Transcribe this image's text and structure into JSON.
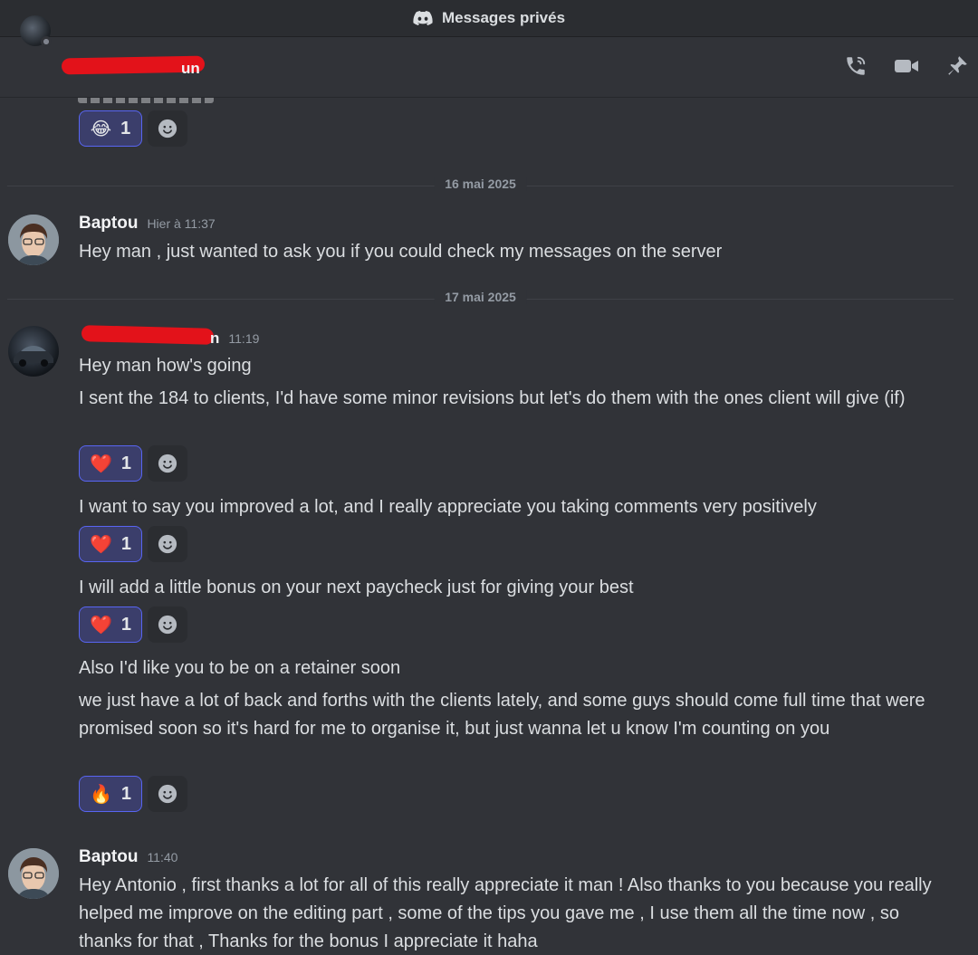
{
  "titlebar": {
    "title": "Messages privés"
  },
  "header": {
    "name_visible_tail": "un"
  },
  "colors": {
    "background": "#313338",
    "accent": "#5865f2",
    "redaction": "#e3121a"
  },
  "reactions": {
    "r0": {
      "emoji": "😂",
      "count": "1"
    },
    "r1": {
      "emoji": "❤️",
      "count": "1"
    },
    "r2": {
      "emoji": "❤️",
      "count": "1"
    },
    "r3": {
      "emoji": "❤️",
      "count": "1"
    },
    "r4": {
      "emoji": "🔥",
      "count": "1"
    }
  },
  "dividers": {
    "d1": "16 mai 2025",
    "d2": "17 mai 2025"
  },
  "messages": {
    "m1": {
      "author": "Baptou",
      "time": "Hier à 11:37",
      "text": "Hey man , just wanted to ask you if you could check my messages on the server"
    },
    "m2": {
      "author_visible_tail": "n",
      "time": "11:19",
      "lines": [
        "Hey man how's going",
        "I sent the 184 to clients, I'd have some minor revisions but let's do them with the ones client will give (if)",
        "I want to say you improved a lot, and I really appreciate you taking comments very positively",
        "I will add a little bonus on your next paycheck just for giving your best",
        "Also I'd like you to be on a retainer soon",
        "we just have a lot of back and forths with the clients lately, and some guys should come full time that were promised soon so it's hard for me to organise it, but just wanna let u know I'm counting on you"
      ]
    },
    "m3": {
      "author": "Baptou",
      "time": "11:40",
      "text": "Hey Antonio , first thanks a lot for all of this really appreciate it man ! Also thanks to you because you really helped me improve on the editing part , some of the tips you gave me , I use them all the time now , so thanks for that , Thanks for the bonus I appreciate it haha"
    }
  }
}
